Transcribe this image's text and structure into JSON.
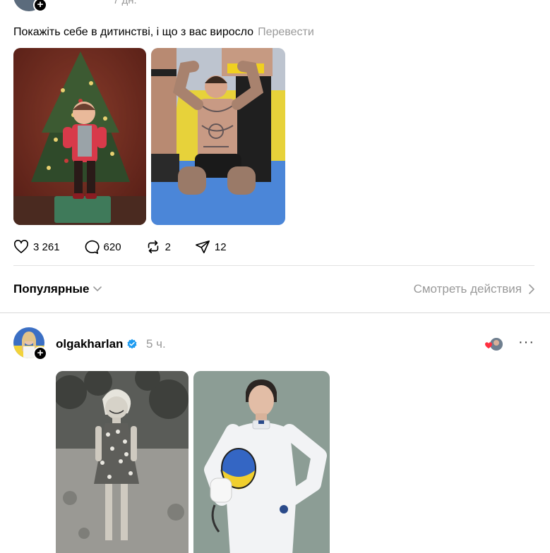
{
  "top_post": {
    "time": "7 дн.",
    "text": "Покажіть себе в дитинстві, і що з вас виросло",
    "translate_label": "Перевести",
    "stats": {
      "likes": "3 261",
      "comments": "620",
      "reposts": "2",
      "shares": "12"
    }
  },
  "sort_bar": {
    "popular_label": "Популярные",
    "view_actions_label": "Смотреть действия"
  },
  "second_post": {
    "username": "olgakharlan",
    "time": "5 ч.",
    "more_label": "···"
  },
  "colors": {
    "verified": "#1d9bf0",
    "heart": "#ff3040",
    "muted": "#999999",
    "divider": "#e2e2e2"
  }
}
